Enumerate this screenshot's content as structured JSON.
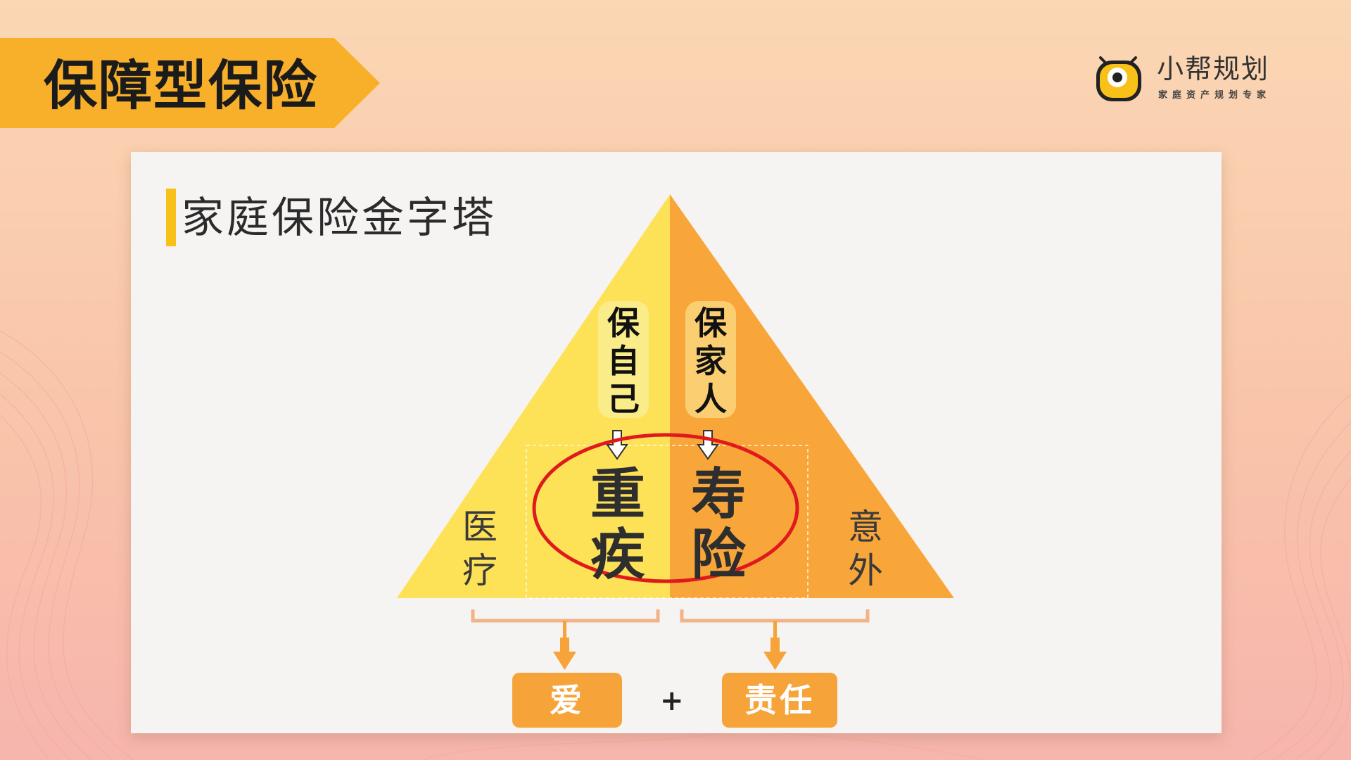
{
  "header": {
    "title": "保障型保险"
  },
  "logo": {
    "name": "小帮规划",
    "tagline": "家庭资产规划专家",
    "icon": "smiley-eye-icon"
  },
  "card": {
    "heading": "家庭保险金字塔"
  },
  "pyramid": {
    "left_outer": [
      "医",
      "疗"
    ],
    "left_inner": [
      "重",
      "疾"
    ],
    "right_inner": [
      "寿",
      "险"
    ],
    "right_outer": [
      "意",
      "外"
    ],
    "pill_left": [
      "保",
      "自",
      "己"
    ],
    "pill_right": [
      "保",
      "家",
      "人"
    ]
  },
  "bottom": {
    "left_label": "爱",
    "plus": "+",
    "right_label": "责任"
  },
  "colors": {
    "banner": "#f8b02a",
    "pyramid_left": "#fde258",
    "pyramid_right": "#f8a63a",
    "highlight_ellipse": "#e0191d",
    "button": "#f6a43a"
  }
}
